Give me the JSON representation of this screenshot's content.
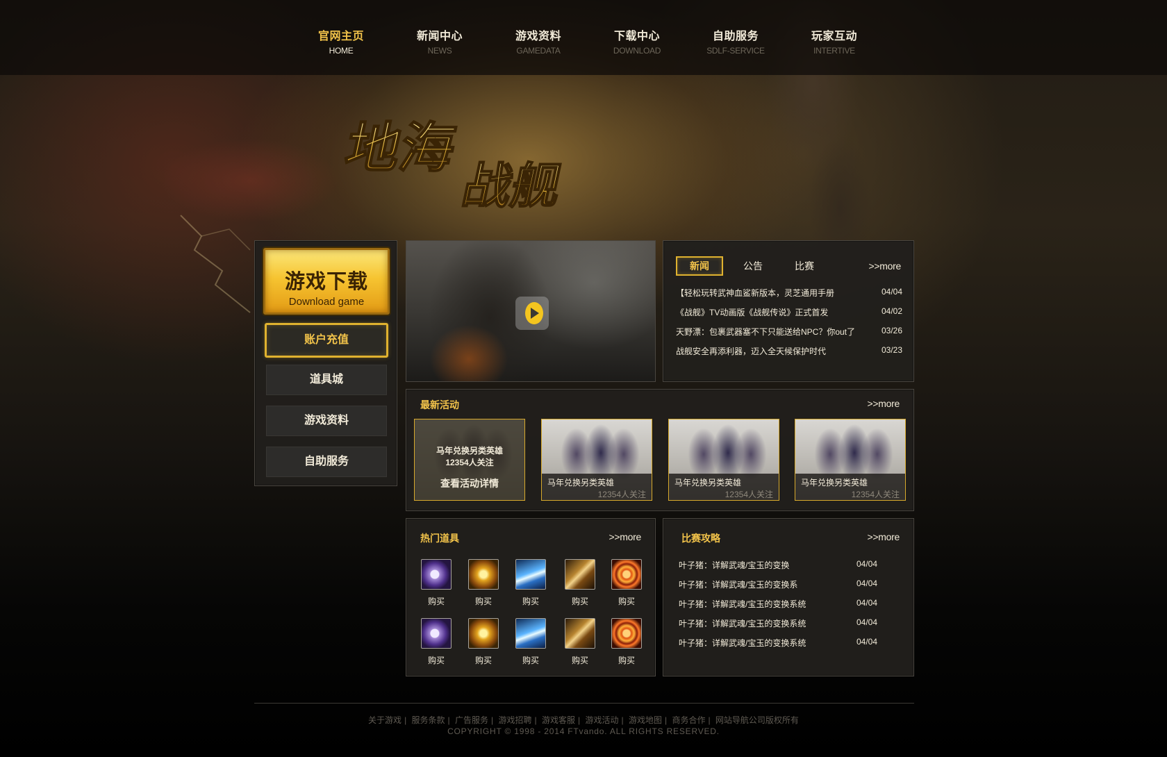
{
  "nav": [
    {
      "cn": "官网主页",
      "en": "HOME"
    },
    {
      "cn": "新闻中心",
      "en": "NEWS"
    },
    {
      "cn": "游戏资料",
      "en": "GAMEDATA"
    },
    {
      "cn": "下载中心",
      "en": "DOWNLOAD"
    },
    {
      "cn": "自助服务",
      "en": "SDLF-SERVICE"
    },
    {
      "cn": "玩家互动",
      "en": "INTERTIVE"
    }
  ],
  "logo_text": "地海战舰",
  "sidebar": {
    "download": {
      "cn": "游戏下载",
      "en": "Download game"
    },
    "recharge": "账户充值",
    "items": [
      "道具城",
      "游戏资料",
      "自助服务"
    ]
  },
  "news": {
    "tabs": [
      "新闻",
      "公告",
      "比赛"
    ],
    "more": ">>more",
    "list": [
      {
        "title": "【轻松玩转武神血鲨新版本，灵芝通用手册",
        "date": "04/04"
      },
      {
        "title": "《战舰》TV动画版《战舰传说》正式首发",
        "date": "04/02"
      },
      {
        "title": "天野漂：包裹武器塞不下只能送给NPC？你out了",
        "date": "03/26"
      },
      {
        "title": "战舰安全再添利器，迈入全天候保护时代",
        "date": "03/23"
      }
    ]
  },
  "activities": {
    "title": "最新活动",
    "more": ">>more",
    "feature": {
      "title": "马年兑换另类英雄",
      "followers": "12354人关注",
      "details": "查看活动详情"
    },
    "cards": [
      {
        "title": "马年兑换另类英雄",
        "followers": "12354人关注"
      },
      {
        "title": "马年兑换另类英雄",
        "followers": "12354人关注"
      },
      {
        "title": "马年兑换另类英雄",
        "followers": "12354人关注"
      }
    ]
  },
  "items": {
    "title": "热门道具",
    "more": ">>more",
    "buy": "购买",
    "icons": [
      "orb-icon",
      "golden-emblem-icon",
      "ice-crystal-icon",
      "claw-icon",
      "fire-ring-icon"
    ]
  },
  "guide": {
    "title": "比赛攻略",
    "more": ">>more",
    "list": [
      {
        "title": "叶子猪：详解武魂/宝玉的变换",
        "date": "04/04"
      },
      {
        "title": "叶子猪：详解武魂/宝玉的变换系",
        "date": "04/04"
      },
      {
        "title": "叶子猪：详解武魂/宝玉的变换系统",
        "date": "04/04"
      },
      {
        "title": "叶子猪：详解武魂/宝玉的变换系统",
        "date": "04/04"
      },
      {
        "title": "叶子猪：详解武魂/宝玉的变换系统",
        "date": "04/04"
      }
    ]
  },
  "footer": {
    "links": [
      "关于游戏",
      "服务条款",
      "广告服务",
      "游戏招聘",
      "游戏客服",
      "游戏活动",
      "游戏地图",
      "商务合作",
      "网站导航公司版权所有"
    ],
    "copyright": "COPYRIGHT © 1998 - 2014 FTvando. ALL RIGHTS RESERVED."
  },
  "colors": {
    "accent": "#f2c34a",
    "panel": "#211f1c",
    "text": "#f1ead8"
  }
}
